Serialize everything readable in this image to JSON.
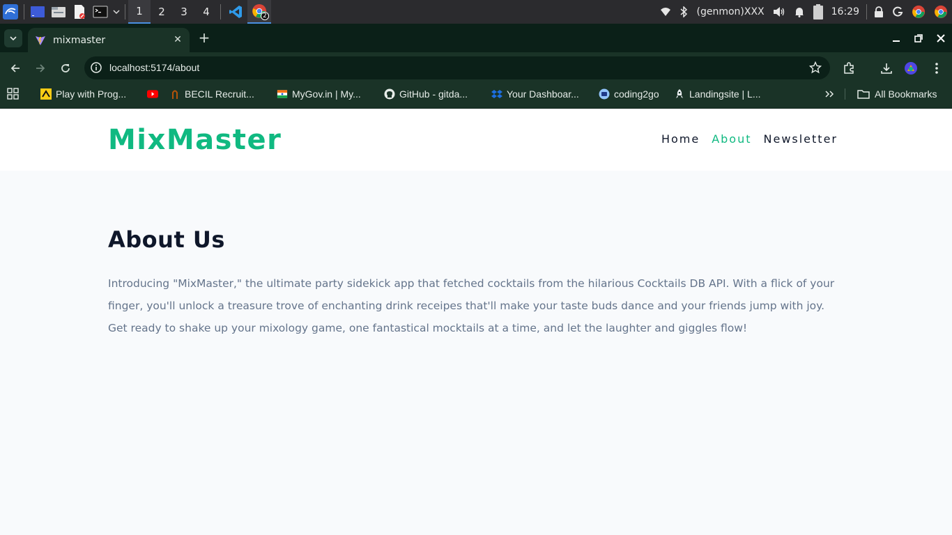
{
  "taskbar": {
    "workspaces": [
      "1",
      "2",
      "3",
      "4"
    ],
    "chrome_badge": "2",
    "genmon": "(genmon)XXX",
    "clock": "16:29"
  },
  "browser": {
    "tab_title": "mixmaster",
    "url": "localhost:5174/about",
    "bookmarks": [
      {
        "label": "Play with Prog...",
        "icon": "yellow-code-icon"
      },
      {
        "label": "",
        "icon": "youtube-icon"
      },
      {
        "label": "BECIL Recruit...",
        "icon": "becil-icon"
      },
      {
        "label": "MyGov.in | My...",
        "icon": "mygov-icon"
      },
      {
        "label": "GitHub - gitda...",
        "icon": "github-icon"
      },
      {
        "label": "Your Dashboar...",
        "icon": "dropbox-icon"
      },
      {
        "label": "coding2go",
        "icon": "coding2go-icon"
      },
      {
        "label": "Landingsite | L...",
        "icon": "rocket-icon"
      }
    ],
    "all_bookmarks": "All Bookmarks"
  },
  "site": {
    "logo": "MixMaster",
    "nav": [
      "Home",
      "About",
      "Newsletter"
    ],
    "active_nav": "About",
    "heading": "About Us",
    "body": "Introducing \"MixMaster,\" the ultimate party sidekick app that fetched cocktails from the hilarious Cocktails DB API. With a flick of your finger, you'll unlock a treasure trove of enchanting drink receipes that'll make your taste buds dance and your friends jump with joy. Get ready to shake up your mixology game, one fantastical mocktails at a time, and let the laughter and giggles flow!"
  },
  "colors": {
    "accent": "#10b981",
    "browser_dark": "#0b2018",
    "browser_toolbar": "#1a3327",
    "page_bg": "#f8fafc",
    "text_dark": "#0f172a",
    "text_muted": "#64748b"
  }
}
